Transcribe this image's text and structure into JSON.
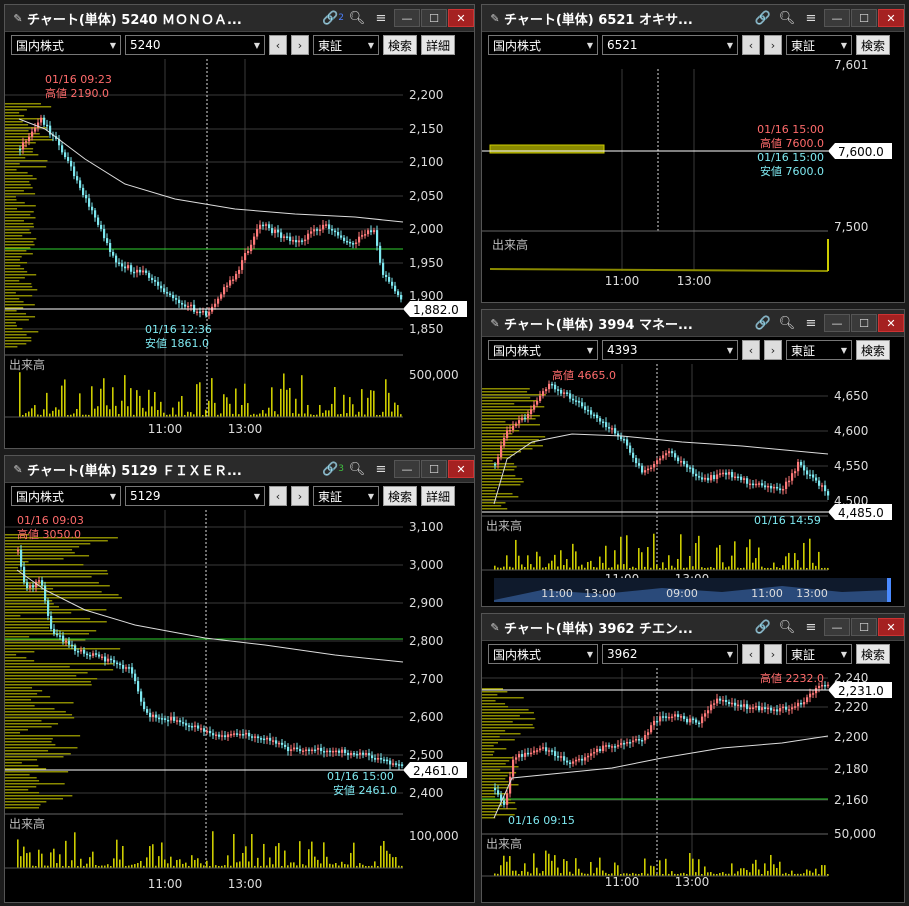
{
  "common": {
    "market_select": "国内株式",
    "exchange_select": "東証",
    "search_label": "検索",
    "detail_label": "詳細",
    "volume_label": "出来高",
    "prev_label": "‹",
    "next_label": "›"
  },
  "panels": {
    "p5240": {
      "title": "チャート(単体) 5240 ＭＯＮＯＡ...",
      "code": "5240",
      "link_badge": "2",
      "high_time": "01/16 09:23",
      "high_label": "高値 2190.0",
      "low_time": "01/16 12:36",
      "low_label": "安値 1861.0",
      "last_price": "1,882.0",
      "y_ticks": [
        "2,200",
        "2,150",
        "2,100",
        "2,050",
        "2,000",
        "1,950",
        "1,900",
        "1,850"
      ],
      "vol_tick": "500,000",
      "x_ticks": [
        "11:00",
        "13:00"
      ]
    },
    "p6521": {
      "title": "チャート(単体) 6521 オキサ...",
      "code": "6521",
      "high_time": "01/16 15:00",
      "high_label": "高値 7600.0",
      "low_time": "01/16 15:00",
      "low_label": "安値 7600.0",
      "last_price": "7,600.0",
      "y_ticks": [
        "7,601",
        "7,500"
      ],
      "x_ticks": [
        "11:00",
        "13:00"
      ]
    },
    "p3994": {
      "title": "チャート(単体) 3994 マネー...",
      "code": "4393",
      "high_label": "高値 4665.0",
      "low_time": "01/16 14:59",
      "last_price": "4,485.0",
      "y_ticks": [
        "4,650",
        "4,600",
        "4,550",
        "4,500"
      ],
      "x_ticks": [
        "11:00",
        "13:00"
      ],
      "nav_ticks": [
        "11:00",
        "13:00",
        "09:00",
        "11:00",
        "13:00"
      ]
    },
    "p5129": {
      "title": "チャート(単体) 5129 ＦＩＸＥＲ...",
      "code": "5129",
      "link_badge": "3",
      "high_time": "01/16 09:03",
      "high_label": "高値 3050.0",
      "low_time": "01/16 15:00",
      "low_label": "安値 2461.0",
      "last_price": "2,461.0",
      "y_ticks": [
        "3,100",
        "3,000",
        "2,900",
        "2,800",
        "2,700",
        "2,600",
        "2,500",
        "2,400"
      ],
      "vol_tick": "100,000",
      "x_ticks": [
        "11:00",
        "13:00"
      ]
    },
    "p3962": {
      "title": "チャート(単体) 3962 チエン...",
      "code": "3962",
      "high_label": "高値 2232.0",
      "low_time": "01/16 09:15",
      "last_price": "2,231.0",
      "y_ticks": [
        "2,240",
        "2,220",
        "2,200",
        "2,180",
        "2,160"
      ],
      "vol_tick": "50,000",
      "x_ticks": [
        "11:00",
        "13:00"
      ]
    }
  },
  "colors": {
    "up": "#ff7a7a",
    "down": "#7ee8f0",
    "ma": "#dddddd",
    "hline": "#2fd12f",
    "volume": "#cccc00",
    "profile": "#8a8a00",
    "hi_text": "#ff6b6b",
    "lo_text": "#7ee8f0"
  }
}
